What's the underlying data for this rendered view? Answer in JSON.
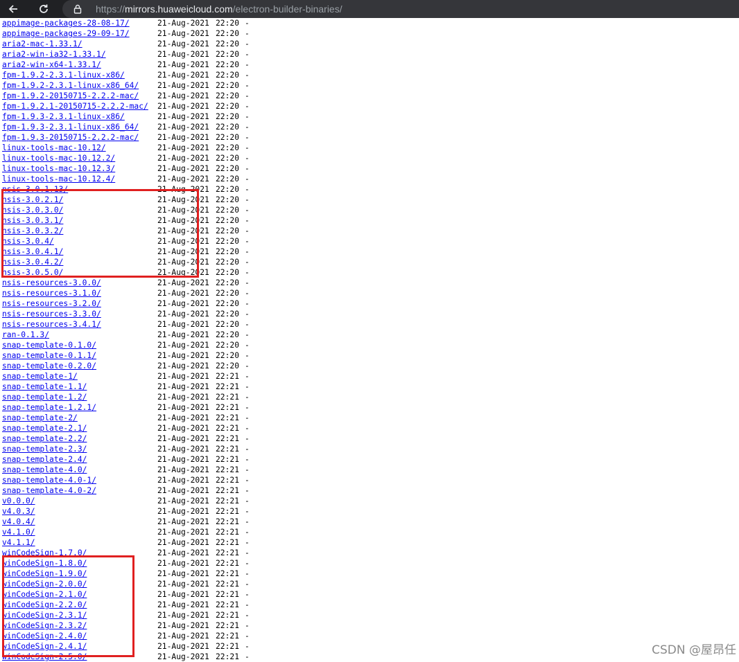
{
  "browser": {
    "url_protocol": "https://",
    "url_domain": "mirrors.huaweicloud.com",
    "url_path": "/electron-builder-binaries/",
    "icons": {
      "back": "back-arrow-icon",
      "reload": "reload-icon",
      "lock": "lock-icon"
    }
  },
  "listing": {
    "rows": [
      {
        "name": "appimage-packages-28-08-17/",
        "date": "21-Aug-2021",
        "time": "22:20",
        "size": "-"
      },
      {
        "name": "appimage-packages-29-09-17/",
        "date": "21-Aug-2021",
        "time": "22:20",
        "size": "-"
      },
      {
        "name": "aria2-mac-1.33.1/",
        "date": "21-Aug-2021",
        "time": "22:20",
        "size": "-"
      },
      {
        "name": "aria2-win-ia32-1.33.1/",
        "date": "21-Aug-2021",
        "time": "22:20",
        "size": "-"
      },
      {
        "name": "aria2-win-x64-1.33.1/",
        "date": "21-Aug-2021",
        "time": "22:20",
        "size": "-"
      },
      {
        "name": "fpm-1.9.2-2.3.1-linux-x86/",
        "date": "21-Aug-2021",
        "time": "22:20",
        "size": "-"
      },
      {
        "name": "fpm-1.9.2-2.3.1-linux-x86_64/",
        "date": "21-Aug-2021",
        "time": "22:20",
        "size": "-"
      },
      {
        "name": "fpm-1.9.2-20150715-2.2.2-mac/",
        "date": "21-Aug-2021",
        "time": "22:20",
        "size": "-"
      },
      {
        "name": "fpm-1.9.2.1-20150715-2.2.2-mac/",
        "date": "21-Aug-2021",
        "time": "22:20",
        "size": "-"
      },
      {
        "name": "fpm-1.9.3-2.3.1-linux-x86/",
        "date": "21-Aug-2021",
        "time": "22:20",
        "size": "-"
      },
      {
        "name": "fpm-1.9.3-2.3.1-linux-x86_64/",
        "date": "21-Aug-2021",
        "time": "22:20",
        "size": "-"
      },
      {
        "name": "fpm-1.9.3-20150715-2.2.2-mac/",
        "date": "21-Aug-2021",
        "time": "22:20",
        "size": "-"
      },
      {
        "name": "linux-tools-mac-10.12/",
        "date": "21-Aug-2021",
        "time": "22:20",
        "size": "-"
      },
      {
        "name": "linux-tools-mac-10.12.2/",
        "date": "21-Aug-2021",
        "time": "22:20",
        "size": "-"
      },
      {
        "name": "linux-tools-mac-10.12.3/",
        "date": "21-Aug-2021",
        "time": "22:20",
        "size": "-"
      },
      {
        "name": "linux-tools-mac-10.12.4/",
        "date": "21-Aug-2021",
        "time": "22:20",
        "size": "-"
      },
      {
        "name": "nsis-3.0.1.13/",
        "date": "21-Aug-2021",
        "time": "22:20",
        "size": "-"
      },
      {
        "name": "nsis-3.0.2.1/",
        "date": "21-Aug-2021",
        "time": "22:20",
        "size": "-"
      },
      {
        "name": "nsis-3.0.3.0/",
        "date": "21-Aug-2021",
        "time": "22:20",
        "size": "-"
      },
      {
        "name": "nsis-3.0.3.1/",
        "date": "21-Aug-2021",
        "time": "22:20",
        "size": "-"
      },
      {
        "name": "nsis-3.0.3.2/",
        "date": "21-Aug-2021",
        "time": "22:20",
        "size": "-"
      },
      {
        "name": "nsis-3.0.4/",
        "date": "21-Aug-2021",
        "time": "22:20",
        "size": "-"
      },
      {
        "name": "nsis-3.0.4.1/",
        "date": "21-Aug-2021",
        "time": "22:20",
        "size": "-"
      },
      {
        "name": "nsis-3.0.4.2/",
        "date": "21-Aug-2021",
        "time": "22:20",
        "size": "-"
      },
      {
        "name": "nsis-3.0.5.0/",
        "date": "21-Aug-2021",
        "time": "22:20",
        "size": "-"
      },
      {
        "name": "nsis-resources-3.0.0/",
        "date": "21-Aug-2021",
        "time": "22:20",
        "size": "-"
      },
      {
        "name": "nsis-resources-3.1.0/",
        "date": "21-Aug-2021",
        "time": "22:20",
        "size": "-"
      },
      {
        "name": "nsis-resources-3.2.0/",
        "date": "21-Aug-2021",
        "time": "22:20",
        "size": "-"
      },
      {
        "name": "nsis-resources-3.3.0/",
        "date": "21-Aug-2021",
        "time": "22:20",
        "size": "-"
      },
      {
        "name": "nsis-resources-3.4.1/",
        "date": "21-Aug-2021",
        "time": "22:20",
        "size": "-"
      },
      {
        "name": "ran-0.1.3/",
        "date": "21-Aug-2021",
        "time": "22:20",
        "size": "-"
      },
      {
        "name": "snap-template-0.1.0/",
        "date": "21-Aug-2021",
        "time": "22:20",
        "size": "-"
      },
      {
        "name": "snap-template-0.1.1/",
        "date": "21-Aug-2021",
        "time": "22:20",
        "size": "-"
      },
      {
        "name": "snap-template-0.2.0/",
        "date": "21-Aug-2021",
        "time": "22:20",
        "size": "-"
      },
      {
        "name": "snap-template-1/",
        "date": "21-Aug-2021",
        "time": "22:21",
        "size": "-"
      },
      {
        "name": "snap-template-1.1/",
        "date": "21-Aug-2021",
        "time": "22:21",
        "size": "-"
      },
      {
        "name": "snap-template-1.2/",
        "date": "21-Aug-2021",
        "time": "22:21",
        "size": "-"
      },
      {
        "name": "snap-template-1.2.1/",
        "date": "21-Aug-2021",
        "time": "22:21",
        "size": "-"
      },
      {
        "name": "snap-template-2/",
        "date": "21-Aug-2021",
        "time": "22:21",
        "size": "-"
      },
      {
        "name": "snap-template-2.1/",
        "date": "21-Aug-2021",
        "time": "22:21",
        "size": "-"
      },
      {
        "name": "snap-template-2.2/",
        "date": "21-Aug-2021",
        "time": "22:21",
        "size": "-"
      },
      {
        "name": "snap-template-2.3/",
        "date": "21-Aug-2021",
        "time": "22:21",
        "size": "-"
      },
      {
        "name": "snap-template-2.4/",
        "date": "21-Aug-2021",
        "time": "22:21",
        "size": "-"
      },
      {
        "name": "snap-template-4.0/",
        "date": "21-Aug-2021",
        "time": "22:21",
        "size": "-"
      },
      {
        "name": "snap-template-4.0-1/",
        "date": "21-Aug-2021",
        "time": "22:21",
        "size": "-"
      },
      {
        "name": "snap-template-4.0-2/",
        "date": "21-Aug-2021",
        "time": "22:21",
        "size": "-"
      },
      {
        "name": "v0.0.0/",
        "date": "21-Aug-2021",
        "time": "22:21",
        "size": "-"
      },
      {
        "name": "v4.0.3/",
        "date": "21-Aug-2021",
        "time": "22:21",
        "size": "-"
      },
      {
        "name": "v4.0.4/",
        "date": "21-Aug-2021",
        "time": "22:21",
        "size": "-"
      },
      {
        "name": "v4.1.0/",
        "date": "21-Aug-2021",
        "time": "22:21",
        "size": "-"
      },
      {
        "name": "v4.1.1/",
        "date": "21-Aug-2021",
        "time": "22:21",
        "size": "-"
      },
      {
        "name": "winCodeSign-1.7.0/",
        "date": "21-Aug-2021",
        "time": "22:21",
        "size": "-"
      },
      {
        "name": "winCodeSign-1.8.0/",
        "date": "21-Aug-2021",
        "time": "22:21",
        "size": "-"
      },
      {
        "name": "winCodeSign-1.9.0/",
        "date": "21-Aug-2021",
        "time": "22:21",
        "size": "-"
      },
      {
        "name": "winCodeSign-2.0.0/",
        "date": "21-Aug-2021",
        "time": "22:21",
        "size": "-"
      },
      {
        "name": "winCodeSign-2.1.0/",
        "date": "21-Aug-2021",
        "time": "22:21",
        "size": "-"
      },
      {
        "name": "winCodeSign-2.2.0/",
        "date": "21-Aug-2021",
        "time": "22:21",
        "size": "-"
      },
      {
        "name": "winCodeSign-2.3.1/",
        "date": "21-Aug-2021",
        "time": "22:21",
        "size": "-"
      },
      {
        "name": "winCodeSign-2.3.2/",
        "date": "21-Aug-2021",
        "time": "22:21",
        "size": "-"
      },
      {
        "name": "winCodeSign-2.4.0/",
        "date": "21-Aug-2021",
        "time": "22:21",
        "size": "-"
      },
      {
        "name": "winCodeSign-2.4.1/",
        "date": "21-Aug-2021",
        "time": "22:21",
        "size": "-"
      },
      {
        "name": "winCodeSign-2.5.0/",
        "date": "21-Aug-2021",
        "time": "22:21",
        "size": "-"
      }
    ]
  },
  "highlight_color": "#e02020",
  "watermark": "CSDN @屋昂任"
}
